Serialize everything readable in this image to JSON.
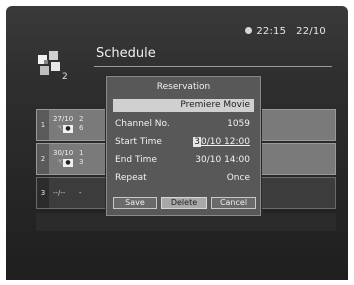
{
  "status": {
    "time": "22:15",
    "date": "22/10"
  },
  "header": {
    "title": "Schedule",
    "logo_icon": "tv-schedule-icon"
  },
  "rows": [
    {
      "num": "1",
      "date": "27/10",
      "detail_line1": "2",
      "detail_line2": "6"
    },
    {
      "num": "2",
      "date": "30/10",
      "detail_line1": "1",
      "detail_line2": "3"
    },
    {
      "num": "3",
      "date": "--/--",
      "detail_line1": "-",
      "detail_line2": ""
    }
  ],
  "dialog": {
    "title": "Reservation",
    "program": "Premiere Movie",
    "fields": {
      "channel_label": "Channel No.",
      "channel_value": "1059",
      "start_label": "Start Time",
      "start_cursor": "3",
      "start_value_rest": "0/10 12:00",
      "end_label": "End Time",
      "end_value": "30/10 14:00",
      "repeat_label": "Repeat",
      "repeat_value": "Once"
    },
    "buttons": {
      "save": "Save",
      "delete": "Delete",
      "cancel": "Cancel"
    }
  }
}
